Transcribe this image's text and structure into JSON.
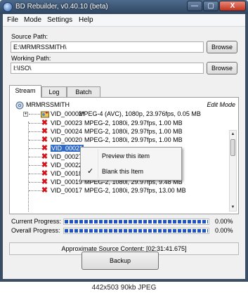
{
  "window": {
    "title": "BD Rebuilder, v0.40.10 (beta)",
    "controls": {
      "minimize": "—",
      "maximize": "▢",
      "close": "X"
    }
  },
  "menu": [
    "File",
    "Mode",
    "Settings",
    "Help"
  ],
  "source": {
    "label": "Source Path:",
    "value": "E:\\MRMRSSMITH\\",
    "browse": "Browse"
  },
  "working": {
    "label": "Working Path:",
    "value": "I:\\ISO\\",
    "browse": "Browse"
  },
  "tabs": [
    "Stream",
    "Log",
    "Batch"
  ],
  "tree": {
    "root": "MRMRSSMITH",
    "edit_mode": "Edit Mode",
    "expander": "+",
    "items": [
      {
        "name": "VID_00002*",
        "info": "MPEG-4 (AVC), 1080p, 23.976fps, 0.05 MB"
      },
      {
        "name": "VID_00023",
        "info": "MPEG-2, 1080i, 29.97fps, 1.00 MB"
      },
      {
        "name": "VID_00024",
        "info": "MPEG-2, 1080i, 29.97fps, 1.00 MB"
      },
      {
        "name": "VID_00020",
        "info": "MPEG-2, 1080i, 29.97fps, 1.00 MB"
      },
      {
        "name": "VID_00021",
        "info": ""
      },
      {
        "name": "VID_00027",
        "info": ""
      },
      {
        "name": "VID_00022",
        "info": ""
      },
      {
        "name": "VID_00018",
        "info": ""
      },
      {
        "name": "VID_00019",
        "info": "MPEG-2, 1080i, 29.97fps, 9.48 MB"
      },
      {
        "name": "VID_00017",
        "info": "MPEG-2, 1080i, 29.97fps, 13.00 MB"
      }
    ],
    "x_mark": "✖"
  },
  "context_menu": {
    "items": [
      {
        "label": "Preview this item",
        "checked": false
      },
      {
        "label": "Blank this Item",
        "checked": true
      }
    ],
    "check_glyph": "✓"
  },
  "progress": {
    "current": {
      "label": "Current Progress:",
      "value": 0.0,
      "text": "0.00%"
    },
    "overall": {
      "label": "Overall Progress:",
      "value": 0.0,
      "text": "0.00%"
    }
  },
  "approx": "Approximate Source Content: [02:31:41.675]",
  "backup_button": "Backup",
  "footer": "442x503 90kb JPEG",
  "colors": {
    "accent": "#316ac5",
    "error": "#d4141a",
    "progress": "#1f54c8"
  }
}
